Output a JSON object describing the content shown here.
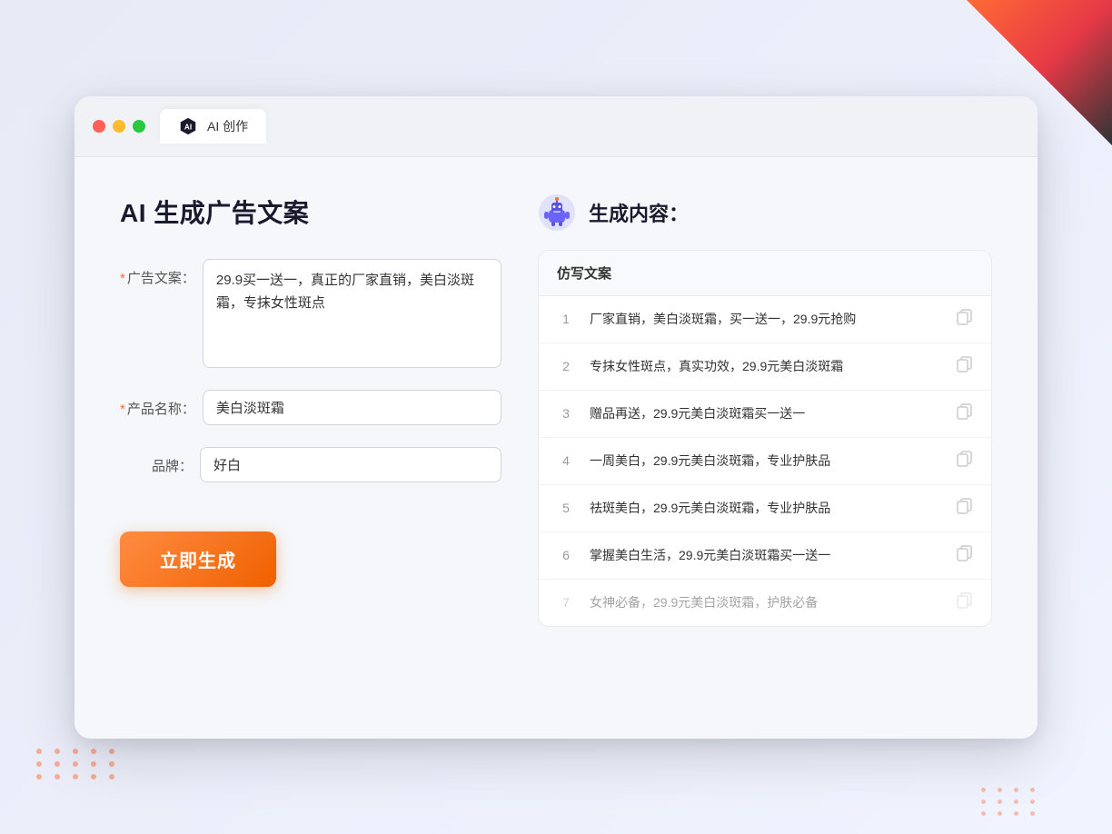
{
  "window": {
    "tab_label": "AI 创作"
  },
  "page": {
    "title": "AI 生成广告文案",
    "result_title": "生成内容："
  },
  "form": {
    "ad_copy_label": "广告文案：",
    "ad_copy_required": true,
    "ad_copy_value": "29.9买一送一，真正的厂家直销，美白淡斑霜，专抹女性斑点",
    "product_name_label": "产品名称：",
    "product_name_required": true,
    "product_name_value": "美白淡斑霜",
    "brand_label": "品牌：",
    "brand_required": false,
    "brand_value": "好白",
    "generate_btn_label": "立即生成"
  },
  "result": {
    "table_header": "仿写文案",
    "items": [
      {
        "num": "1",
        "text": "厂家直销，美白淡斑霜，买一送一，29.9元抢购",
        "faded": false
      },
      {
        "num": "2",
        "text": "专抹女性斑点，真实功效，29.9元美白淡斑霜",
        "faded": false
      },
      {
        "num": "3",
        "text": "赠品再送，29.9元美白淡斑霜买一送一",
        "faded": false
      },
      {
        "num": "4",
        "text": "一周美白，29.9元美白淡斑霜，专业护肤品",
        "faded": false
      },
      {
        "num": "5",
        "text": "祛斑美白，29.9元美白淡斑霜，专业护肤品",
        "faded": false
      },
      {
        "num": "6",
        "text": "掌握美白生活，29.9元美白淡斑霜买一送一",
        "faded": false
      },
      {
        "num": "7",
        "text": "女神必备，29.9元美白淡斑霜，护肤必备",
        "faded": true
      }
    ]
  },
  "colors": {
    "accent_orange": "#f06000",
    "required_mark": "#ff6b35",
    "primary_text": "#1a1a2e"
  }
}
